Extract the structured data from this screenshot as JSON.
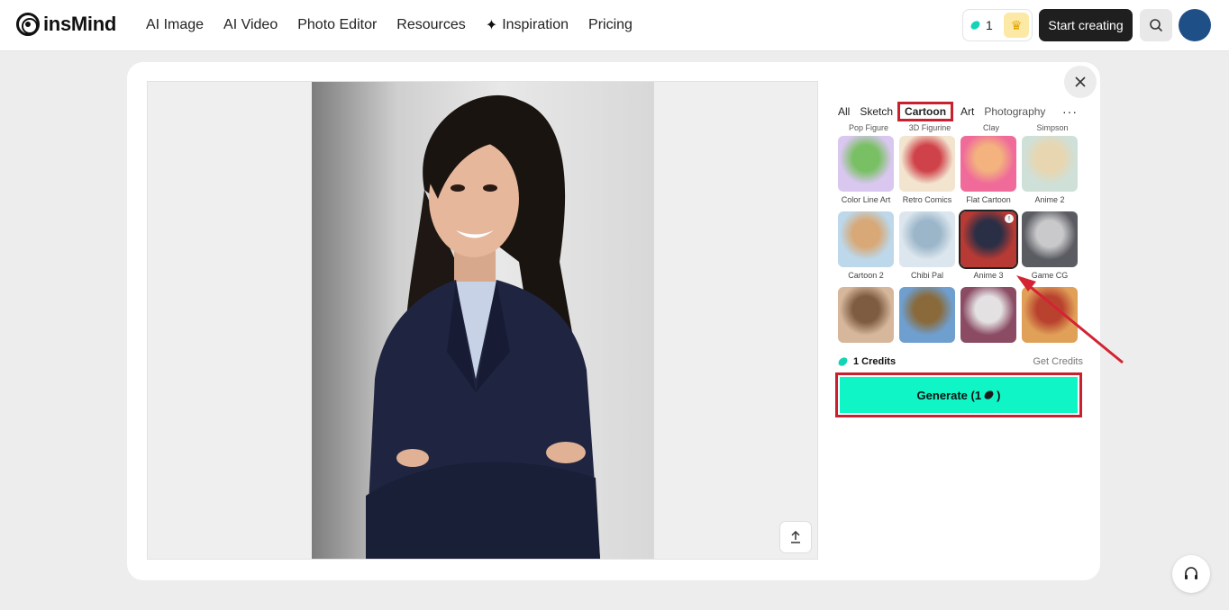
{
  "header": {
    "logo_text": "insMind",
    "nav": [
      {
        "label": "AI Image"
      },
      {
        "label": "AI Video"
      },
      {
        "label": "Photo Editor"
      },
      {
        "label": "Resources"
      },
      {
        "label": "Inspiration",
        "icon": "sparkle-icon"
      },
      {
        "label": "Pricing"
      }
    ],
    "credit_count": "1",
    "start_button": "Start creating",
    "icons": {
      "search": "search-icon",
      "premium": "crown-icon"
    }
  },
  "modal": {
    "close_icon": "close-icon",
    "upload_icon": "upload-icon"
  },
  "styles": {
    "categories": [
      {
        "label": "All"
      },
      {
        "label": "Sketch"
      },
      {
        "label": "Cartoon",
        "active": true
      },
      {
        "label": "Art"
      },
      {
        "label": "Photography"
      }
    ],
    "more_label": "···",
    "top_labels": [
      "Pop Figure",
      "3D Figurine",
      "Clay",
      "Simpson"
    ],
    "tiles": [
      {
        "name": "Color Line Art",
        "c1": "#d9c7f0",
        "c2": "#79c064"
      },
      {
        "name": "Retro Comics",
        "c1": "#f2e4cf",
        "c2": "#d0424a"
      },
      {
        "name": "Flat Cartoon",
        "c1": "#f06a9a",
        "c2": "#f3b27e"
      },
      {
        "name": "Anime 2",
        "c1": "#cfe0d8",
        "c2": "#e8d6b0"
      },
      {
        "name": "Cartoon 2",
        "c1": "#bcd8ea",
        "c2": "#d8a876"
      },
      {
        "name": "Chibi Pal",
        "c1": "#dce6ee",
        "c2": "#9bb6c9"
      },
      {
        "name": "Anime 3",
        "c1": "#b83a34",
        "c2": "#2a2f45",
        "selected": true
      },
      {
        "name": "Game CG",
        "c1": "#5a5c62",
        "c2": "#c9c9cb"
      },
      {
        "name": "",
        "c1": "#d7b79c",
        "c2": "#7d5c42"
      },
      {
        "name": "",
        "c1": "#6f9fcf",
        "c2": "#8a6a3a"
      },
      {
        "name": "",
        "c1": "#8a4b63",
        "c2": "#e4e1e2"
      },
      {
        "name": "",
        "c1": "#e0a058",
        "c2": "#b8422e"
      }
    ],
    "credits_label": "1 Credits",
    "get_credits": "Get Credits",
    "generate_label": "Generate (1",
    "generate_suffix": ")"
  },
  "help_icon": "headset-icon",
  "colors": {
    "accent": "#0ff5c6",
    "highlight": "#c8202e",
    "dark_button": "#1f1f1f"
  }
}
